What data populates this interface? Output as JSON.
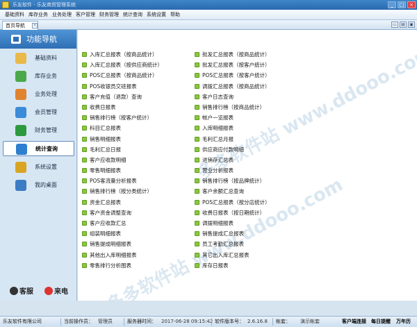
{
  "titlebar": {
    "title": "乐友软件 - 乐友商贸管理系统"
  },
  "menu": [
    "基础资料",
    "库存业务",
    "业务处理",
    "客户管理",
    "财务管理",
    "统计查询",
    "系统设置",
    "帮助"
  ],
  "tab": {
    "label": "首页导航"
  },
  "sidebar": {
    "title": "功能导航",
    "items": [
      {
        "label": "基础资料",
        "icon": "pencil-icon",
        "color": "#e9b949"
      },
      {
        "label": "库存业务",
        "icon": "house-icon",
        "color": "#4aa84a"
      },
      {
        "label": "业务处理",
        "icon": "gear-icon",
        "color": "#e0832f"
      },
      {
        "label": "会员管理",
        "icon": "users-icon",
        "color": "#3b8bd8"
      },
      {
        "label": "财务管理",
        "icon": "chart-line-icon",
        "color": "#2d9a3f"
      },
      {
        "label": "统计查询",
        "icon": "bar-chart-icon",
        "color": "#2f7fd0"
      },
      {
        "label": "系统设置",
        "icon": "settings-icon",
        "color": "#d9a423"
      },
      {
        "label": "我的桌面",
        "icon": "monitor-icon",
        "color": "#3c7cc4"
      }
    ],
    "active_index": 5,
    "footer": {
      "service_label": "客服",
      "call_label": "来电"
    }
  },
  "reports": {
    "left": [
      "入库汇总报表（按商品统计）",
      "入库汇总报表（按供应商统计）",
      "POS汇总报表（按商品统计）",
      "POS收银员交班报表",
      "客户充值（退款）查询",
      "收费日报表",
      "销售排行榜（按客户统计）",
      "科目汇总报表",
      "销售明细报表",
      "毛利汇总日报",
      "客户应收款明细",
      "零售明细报表",
      "POS客流量分析报表",
      "销售排行榜（按分类统计）",
      "资金汇总报表",
      "客户资金调整查询",
      "客户应收款汇总",
      "组装明细报表",
      "销售提成明细报表",
      "其他出入库明细报表",
      "零售排行分析图表"
    ],
    "right": [
      "批发汇总报表（按商品统计）",
      "批发汇总报表（按客户统计）",
      "POS汇总报表（按客户统计）",
      "调拨汇总报表（按商品统计）",
      "客户日志查询",
      "销售排行榜（按商品统计）",
      "帐户一览报表",
      "入库明细报表",
      "毛利汇总月报",
      "供应商应付款明细",
      "进销存汇总表",
      "营业分析报表",
      "销售排行榜（按品牌统计）",
      "客户余额汇总查询",
      "POS汇总报表（按分店统计）",
      "收费日报表（按日期统计）",
      "调拨明细报表",
      "销售提成汇总报表",
      "员工考勤汇总报表",
      "其它出入库汇总报表",
      "库存日报表"
    ]
  },
  "watermark": "多多软件站 www.ddooo.com",
  "status": {
    "company": "乐友软件有限公司",
    "operator_label": "当前操作员：",
    "operator": "管理员",
    "server_time_label": "服务器时间：",
    "server_time": "2017-06-28 09:15:42",
    "version_label": "软件版本号：",
    "version": "2.6.16.8",
    "account_label": "帐套：",
    "account": "演示帐套",
    "client_status": "客户端连接",
    "daily_reminder": "每日提醒",
    "calendar": "万年历"
  }
}
